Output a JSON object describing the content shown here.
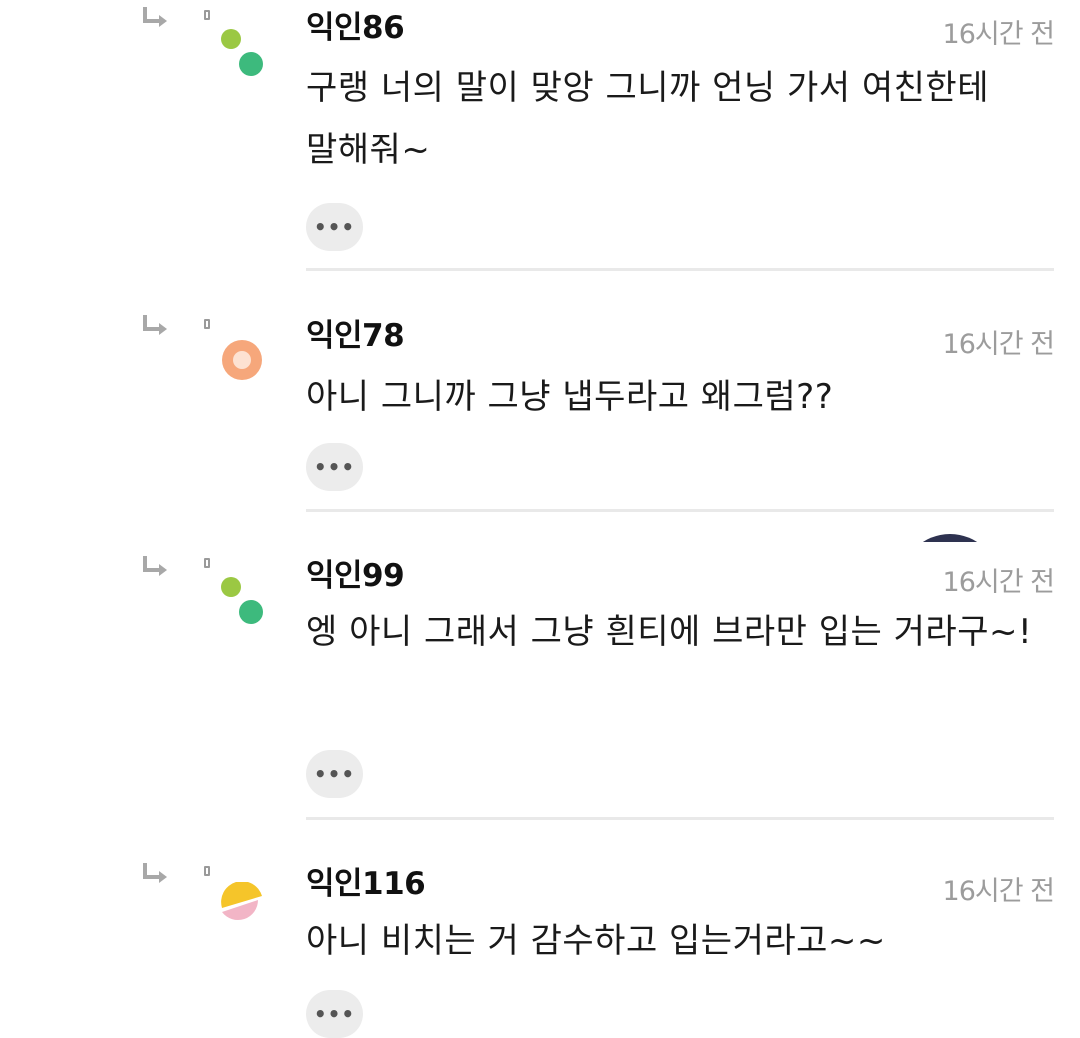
{
  "comments": [
    {
      "nickname": "익인86",
      "time": "16시간 전",
      "text": "구랭 너의 말이 맞앙 그니까 언닝 가서 여친한테 말해줘~",
      "avatar": "green-dots",
      "more_label": "•••"
    },
    {
      "nickname": "익인78",
      "time": "16시간 전",
      "text": "아니 그니까 그냥 냅두라고 왜그럼??",
      "avatar": "orange-ring",
      "more_label": "•••"
    },
    {
      "nickname": "익인99",
      "time": "16시간 전",
      "text": "엥 아니 그래서 그냥 흰티에 브라만 입는 거라구~!",
      "avatar": "green-dots",
      "more_label": "•••"
    },
    {
      "nickname": "익인116",
      "time": "16시간 전",
      "text": "아니 비치는 거 감수하고 입는거라고~~",
      "avatar": "yellow-pink-halves",
      "more_label": "•••"
    }
  ],
  "colors": {
    "green_small": "#9bc843",
    "green_large": "#3dba7d",
    "orange": "#f6a77b",
    "yellow": "#f5c52a",
    "pink": "#f2b5c6",
    "divider": "#e9e9e9",
    "time_gray": "#9c9c9c"
  },
  "icons": {
    "reply": "reply-arrow-icon",
    "more": "more-dots-icon"
  }
}
